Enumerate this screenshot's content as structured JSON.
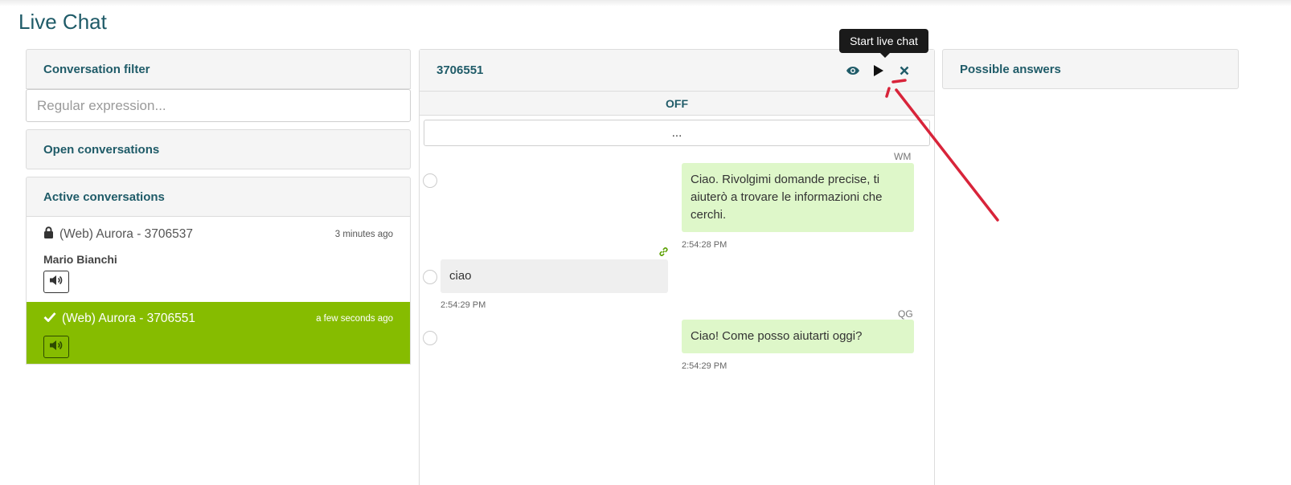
{
  "page": {
    "title": "Live Chat"
  },
  "filter": {
    "header": "Conversation filter",
    "placeholder": "Regular expression..."
  },
  "open_conversations": {
    "header": "Open conversations"
  },
  "active_conversations": {
    "header": "Active conversations",
    "items": [
      {
        "icon": "lock-icon",
        "name": "(Web) Aurora  - 3706537",
        "time": "3 minutes ago",
        "user": "Mario Bianchi",
        "selected": false
      },
      {
        "icon": "check-icon",
        "name": "(Web) Aurora  - 3706551",
        "time": "a few seconds ago",
        "user": "",
        "selected": true
      }
    ]
  },
  "chat": {
    "id": "3706551",
    "status": "OFF",
    "load_more": "...",
    "tooltip": "Start live chat",
    "actions": [
      "eye-icon",
      "play-icon",
      "close-icon"
    ],
    "messages": [
      {
        "sender": "bot",
        "initials": "WM",
        "text": "Ciao. Rivolgimi domande precise, ti aiuterò a trovare le informazioni che cerchi.",
        "time": "2:54:28 PM"
      },
      {
        "sender": "user",
        "initials": "",
        "text": "ciao",
        "time": "2:54:29 PM"
      },
      {
        "sender": "bot",
        "initials": "QG",
        "text": "Ciao! Come posso aiutarti oggi?",
        "time": "2:54:29 PM"
      }
    ]
  },
  "possible_answers": {
    "header": "Possible answers"
  },
  "colors": {
    "accent": "#1f5b68",
    "active_green": "#86bc00",
    "bot_bubble": "#def7c9",
    "user_bubble": "#efefef",
    "annotation_red": "#d8243a",
    "link_green": "#5aa000"
  }
}
